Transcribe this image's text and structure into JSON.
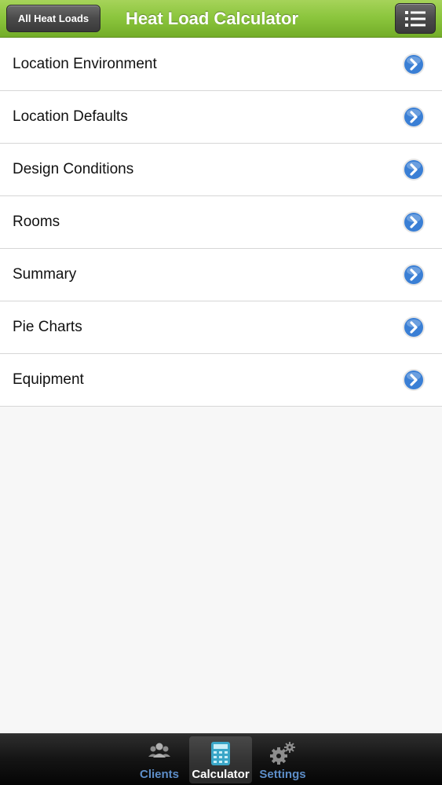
{
  "nav": {
    "back_label": "All Heat Loads",
    "title": "Heat Load Calculator",
    "menu_icon": "list-icon"
  },
  "menu": {
    "items": [
      {
        "label": "Location Environment"
      },
      {
        "label": "Location Defaults"
      },
      {
        "label": "Design Conditions"
      },
      {
        "label": "Rooms"
      },
      {
        "label": "Summary"
      },
      {
        "label": "Pie Charts"
      },
      {
        "label": "Equipment"
      }
    ],
    "disclosure_icon": "chevron-right-circle-icon"
  },
  "tabbar": {
    "tabs": [
      {
        "label": "Clients",
        "icon": "people-icon"
      },
      {
        "label": "Calculator",
        "icon": "calculator-icon",
        "selected": true
      },
      {
        "label": "Settings",
        "icon": "gears-icon"
      }
    ]
  },
  "colors": {
    "nav_green": "#8cc63e",
    "disclosure_blue": "#3a7fd5",
    "tab_inactive": "#5d8ec9"
  }
}
